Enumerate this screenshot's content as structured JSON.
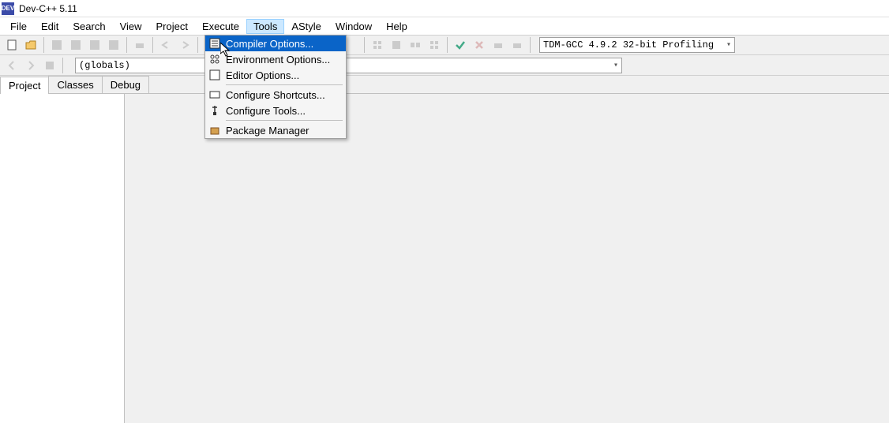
{
  "titlebar": {
    "app_icon_text": "DEV",
    "title": "Dev-C++ 5.11"
  },
  "menubar": {
    "items": [
      "File",
      "Edit",
      "Search",
      "View",
      "Project",
      "Execute",
      "Tools",
      "AStyle",
      "Window",
      "Help"
    ],
    "active_index": 6
  },
  "toolbar": {
    "compiler": "TDM-GCC 4.9.2 32-bit Profiling"
  },
  "toolbar2": {
    "globals": "(globals)"
  },
  "tabs": {
    "items": [
      "Project",
      "Classes",
      "Debug"
    ],
    "active_index": 0
  },
  "dropdown": {
    "items": [
      {
        "label": "Compiler Options...",
        "icon": "compiler-options-icon",
        "highlighted": true
      },
      {
        "label": "Environment Options...",
        "icon": "environment-options-icon"
      },
      {
        "label": "Editor Options...",
        "icon": "editor-options-icon"
      },
      {
        "sep": true
      },
      {
        "label": "Configure Shortcuts...",
        "icon": "shortcuts-icon"
      },
      {
        "label": "Configure Tools...",
        "icon": "tools-icon"
      },
      {
        "sep": true
      },
      {
        "label": "Package Manager",
        "icon": "package-manager-icon"
      }
    ]
  }
}
